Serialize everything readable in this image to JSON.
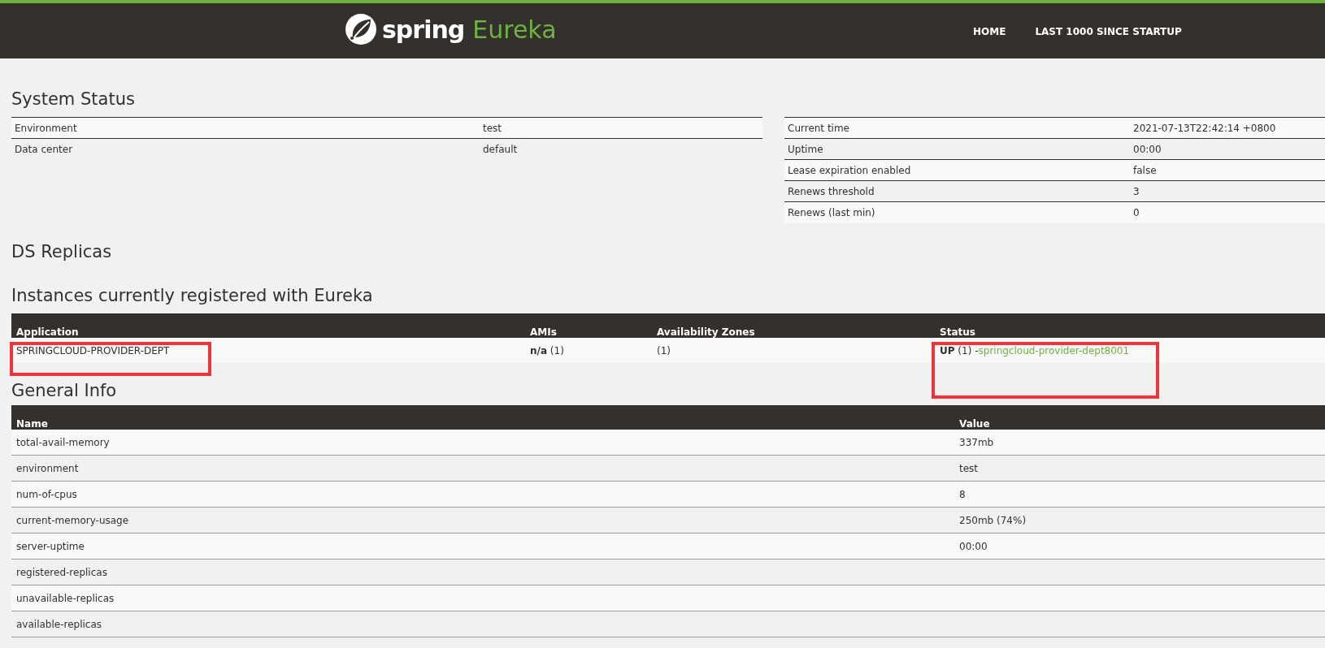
{
  "header": {
    "brand": "spring",
    "product": "Eureka",
    "nav": [
      {
        "label": "HOME"
      },
      {
        "label": "LAST 1000 SINCE STARTUP"
      }
    ]
  },
  "system_status": {
    "title": "System Status",
    "left": [
      {
        "name": "Environment",
        "value": "test"
      },
      {
        "name": "Data center",
        "value": "default"
      }
    ],
    "right": [
      {
        "name": "Current time",
        "value": "2021-07-13T22:42:14 +0800"
      },
      {
        "name": "Uptime",
        "value": "00:00"
      },
      {
        "name": "Lease expiration enabled",
        "value": "false"
      },
      {
        "name": "Renews threshold",
        "value": "3"
      },
      {
        "name": "Renews (last min)",
        "value": "0"
      }
    ]
  },
  "ds_replicas": {
    "title": "DS Replicas"
  },
  "instances": {
    "title": "Instances currently registered with Eureka",
    "columns": [
      "Application",
      "AMIs",
      "Availability Zones",
      "Status"
    ],
    "rows": [
      {
        "application": "SPRINGCLOUD-PROVIDER-DEPT",
        "amis": "**n/a** (1)",
        "zones": "(1)",
        "status": "**UP** (1) -",
        "instance_link": "springcloud-provider-dept8001",
        "application_highlighted": true,
        "status_highlighted": true
      }
    ]
  },
  "general_info": {
    "title": "General Info",
    "columns": [
      "Name",
      "Value"
    ],
    "rows": [
      {
        "name": "total-avail-memory",
        "value": "337mb"
      },
      {
        "name": "environment",
        "value": "test"
      },
      {
        "name": "num-of-cpus",
        "value": "8"
      },
      {
        "name": "current-memory-usage",
        "value": "250mb (74%)"
      },
      {
        "name": "server-uptime",
        "value": "00:00"
      },
      {
        "name": "registered-replicas"
      },
      {
        "name": "unavailable-replicas"
      },
      {
        "name": "available-replicas"
      }
    ]
  }
}
